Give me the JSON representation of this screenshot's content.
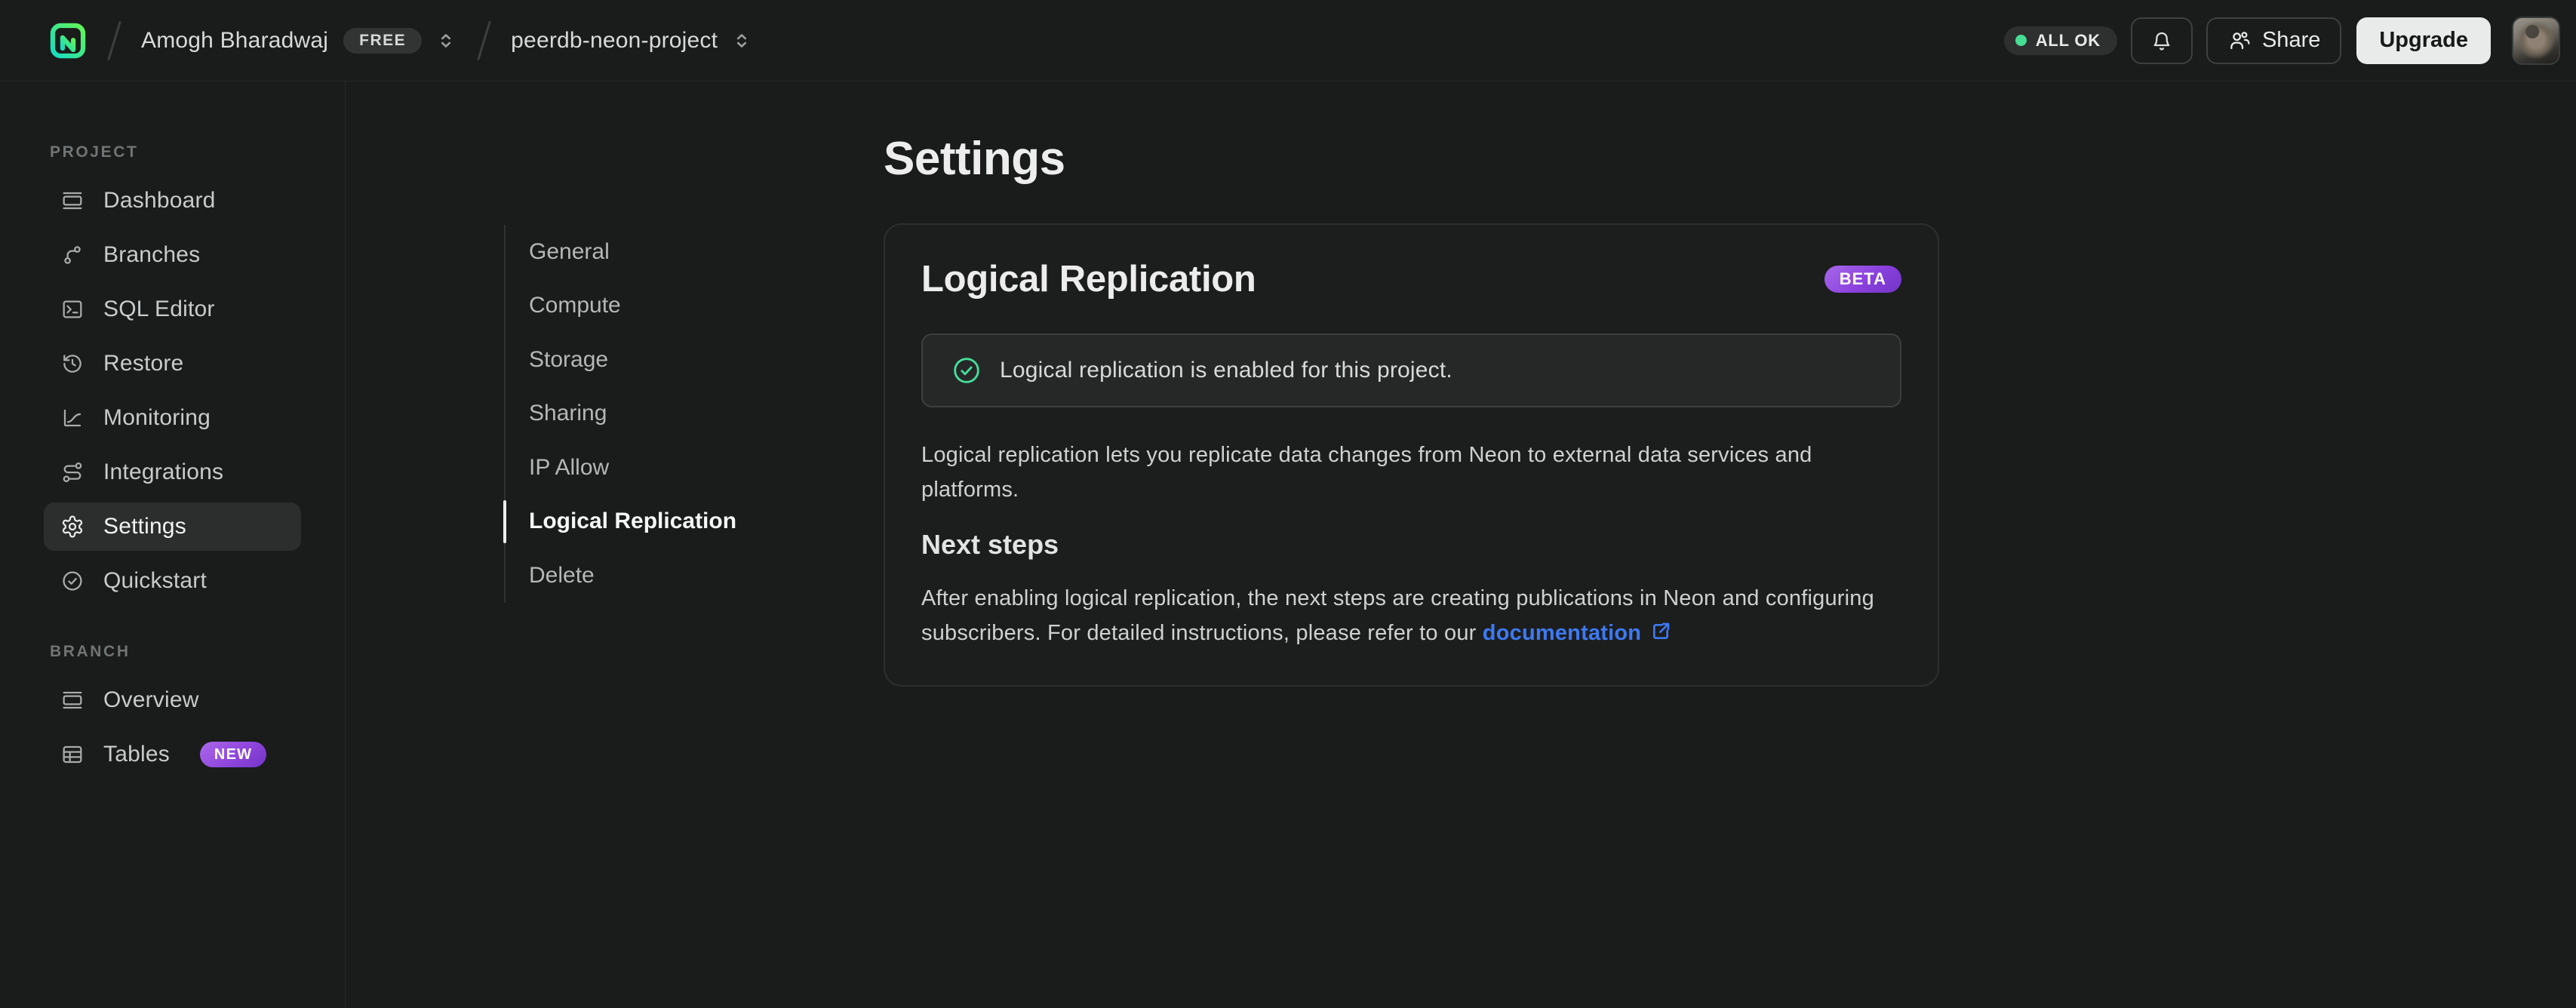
{
  "brand_colors": {
    "logo_green": "#63f655",
    "logo_teal": "#16dac4",
    "accent_green": "#46de95",
    "badge_purple": "#8a41dd",
    "link_blue": "#3d79f2"
  },
  "header": {
    "breadcrumb": {
      "org_name": "Amogh Bharadwaj",
      "org_plan_badge": "FREE",
      "project_name": "peerdb-neon-project"
    },
    "status_pill_label": "ALL OK",
    "share_button_label": "Share",
    "upgrade_button_label": "Upgrade"
  },
  "sidebar": {
    "sections": [
      {
        "label": "PROJECT",
        "items": [
          {
            "label": "Dashboard",
            "icon": "dashboard-icon"
          },
          {
            "label": "Branches",
            "icon": "branches-icon"
          },
          {
            "label": "SQL Editor",
            "icon": "sql-editor-icon"
          },
          {
            "label": "Restore",
            "icon": "restore-icon"
          },
          {
            "label": "Monitoring",
            "icon": "monitoring-icon"
          },
          {
            "label": "Integrations",
            "icon": "integrations-icon"
          },
          {
            "label": "Settings",
            "icon": "settings-icon",
            "active": true
          },
          {
            "label": "Quickstart",
            "icon": "quickstart-icon"
          }
        ]
      },
      {
        "label": "BRANCH",
        "items": [
          {
            "label": "Overview",
            "icon": "overview-icon"
          },
          {
            "label": "Tables",
            "icon": "tables-icon",
            "badge": "NEW"
          }
        ]
      }
    ]
  },
  "page": {
    "title": "Settings"
  },
  "subnav": {
    "items": [
      {
        "label": "General"
      },
      {
        "label": "Compute"
      },
      {
        "label": "Storage"
      },
      {
        "label": "Sharing"
      },
      {
        "label": "IP Allow"
      },
      {
        "label": "Logical Replication",
        "active": true
      },
      {
        "label": "Delete"
      }
    ]
  },
  "card": {
    "title": "Logical Replication",
    "badge": "BETA",
    "alert_text": "Logical replication is enabled for this project.",
    "description_line1": "Logical replication lets you replicate data changes from Neon to external data services and",
    "description_line2": "platforms.",
    "next_steps_title": "Next steps",
    "next_steps_line1": "After enabling logical replication, the next steps are creating publications in Neon and configuring",
    "next_steps_line2_prefix": "subscribers. For detailed instructions, please refer to our ",
    "link_text": "documentation"
  }
}
